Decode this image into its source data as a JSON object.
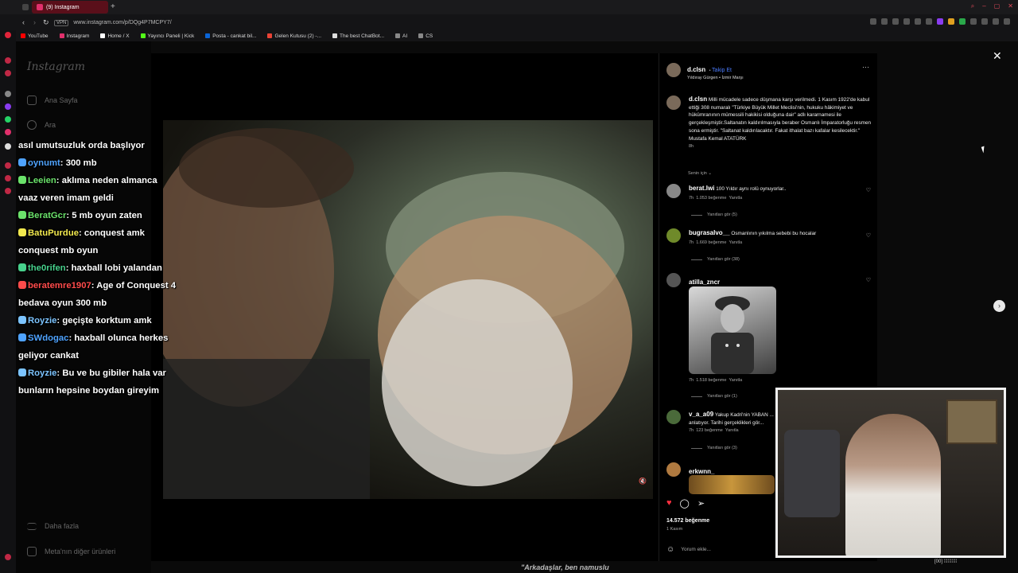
{
  "browser": {
    "tab_title": "(9) Instagram",
    "url": "www.instagram.com/p/DQg4P7MCPY7/",
    "vpn_label": "VPN",
    "bookmarks": [
      {
        "label": "YouTube",
        "icon": "youtube-icon",
        "color": "#ff0000"
      },
      {
        "label": "Instagram",
        "icon": "instagram-icon",
        "color": "#e1306c"
      },
      {
        "label": "Home / X",
        "icon": "x-icon",
        "color": "#ffffff"
      },
      {
        "label": "Yayıncı Paneli | Kick",
        "icon": "kick-icon",
        "color": "#53fc18"
      },
      {
        "label": "Posta - cankat bil...",
        "icon": "outlook-icon",
        "color": "#0a64d6"
      },
      {
        "label": "Gelen Kutusu (2) -...",
        "icon": "gmail-icon",
        "color": "#ea4335"
      },
      {
        "label": "The best ChatBot...",
        "icon": "chatbot-icon",
        "color": "#dddddd"
      },
      {
        "label": "AI",
        "icon": "folder-icon",
        "color": "#888888"
      },
      {
        "label": "CS",
        "icon": "folder-icon",
        "color": "#888888"
      }
    ]
  },
  "instagram": {
    "logo": "Instagram",
    "nav": [
      {
        "label": "Ana Sayfa",
        "icon": "home-icon"
      },
      {
        "label": "Ara",
        "icon": "search-icon"
      }
    ],
    "nav_more": "Daha fazla",
    "nav_meta": "Meta'nın diğer ürünleri"
  },
  "chat": [
    {
      "user": "",
      "text": "asıl umutsuzluk orda başlıyor",
      "color": "#ffffff"
    },
    {
      "user": "oynumt",
      "text": ": 300 mb",
      "color": "#4fa3ff"
    },
    {
      "user": "Leeien",
      "text": ": aklıma neden almanca vaaz veren imam geldi",
      "color": "#6be36b"
    },
    {
      "user": "BeratGcr",
      "text": ": 5 mb oyun zaten",
      "color": "#6be36b"
    },
    {
      "user": "BatuPurdue",
      "text": ": conquest amk conquest mb oyun",
      "color": "#f2e94e"
    },
    {
      "user": "the0rifen",
      "text": ": haxball lobi yalandan",
      "color": "#47d18c"
    },
    {
      "user": "beratemre1907",
      "text": ": Age of Conquest 4 bedava oyun 300 mb",
      "color": "#ff4b4b"
    },
    {
      "user": "Royzie",
      "text": ": geçişte korktum amk",
      "color": "#7cc4ff"
    },
    {
      "user": "SWdogac",
      "text": ": haxball olunca herkes geliyor cankat",
      "color": "#4fa3ff"
    },
    {
      "user": "Royzie",
      "text": ": Bu ve bu gibiler hala var bunların hepsine boydan gireyim",
      "color": "#7cc4ff"
    }
  ],
  "post": {
    "author": "d.clsn",
    "follow_label": "Takip Et",
    "audio": "Yıldıray Gürgen • İzmir Marşı",
    "caption_user": "d.clsn",
    "caption": "Milli mücadele sadece düşmana karşı verilmedi. 1 Kasım 1922'de kabul ettiği 308 numaralı \"Türkiye Büyük Millet Meclisi'nin, hukuku hâkimiyet ve hükümranının mümessili hakikisi olduğuna dair\" adlı kararnamesi ile gerçekleşmiştir.Saltanatın kaldırılmasıyla beraber Osmanlı İmparatorluğu resmen sona ermiştir. \"Saltanat kaldırılacaktır. Fakat ithalat bazı kafalar kesilecektir.\" Mustafa Kemal ATATÜRK",
    "caption_time": "8h",
    "sort_label": "Senin için ⌄",
    "likes": "14.572 beğenme",
    "date": "1 Kasım",
    "comment_placeholder": "Yorum ekle...",
    "comments": [
      {
        "user": "berat.lwi",
        "text": "100 Yıldır aynı rolü oynuyorlar..",
        "time": "7h",
        "likes": "1.053 beğenme",
        "reply": "Yanıtla",
        "replies": "Yanıtları gör (5)"
      },
      {
        "user": "bugrasalvo__",
        "text": "Osmanlının yıkılma sebebi bu hocalar",
        "time": "7h",
        "likes": "1.669 beğenme",
        "reply": "Yanıtla",
        "replies": "Yanıtları gör (38)"
      },
      {
        "user": "atilla_zncr",
        "text": "",
        "time": "7h",
        "likes": "1.518 beğenme",
        "reply": "Yanıtla",
        "replies": "Yanıtları gör (1)"
      },
      {
        "user": "v_a_a09",
        "text": "Yakup Kadri'nin YABAN ... anlatıyor. Tarihi gerçeklikleri gör...",
        "time": "7h",
        "likes": "123 beğenme",
        "reply": "Yanıtla",
        "replies": "Yanıtları gör (3)"
      },
      {
        "user": "erkwnn_",
        "text": "",
        "time": "",
        "likes": "",
        "reply": "",
        "replies": ""
      }
    ]
  },
  "overlay": {
    "bottom_caption": "\"Arkadaşlar, ben namuslu",
    "status": "[00] ⁞⁞⁞⁞⁞⁞⁞⁞⁞⁞"
  }
}
